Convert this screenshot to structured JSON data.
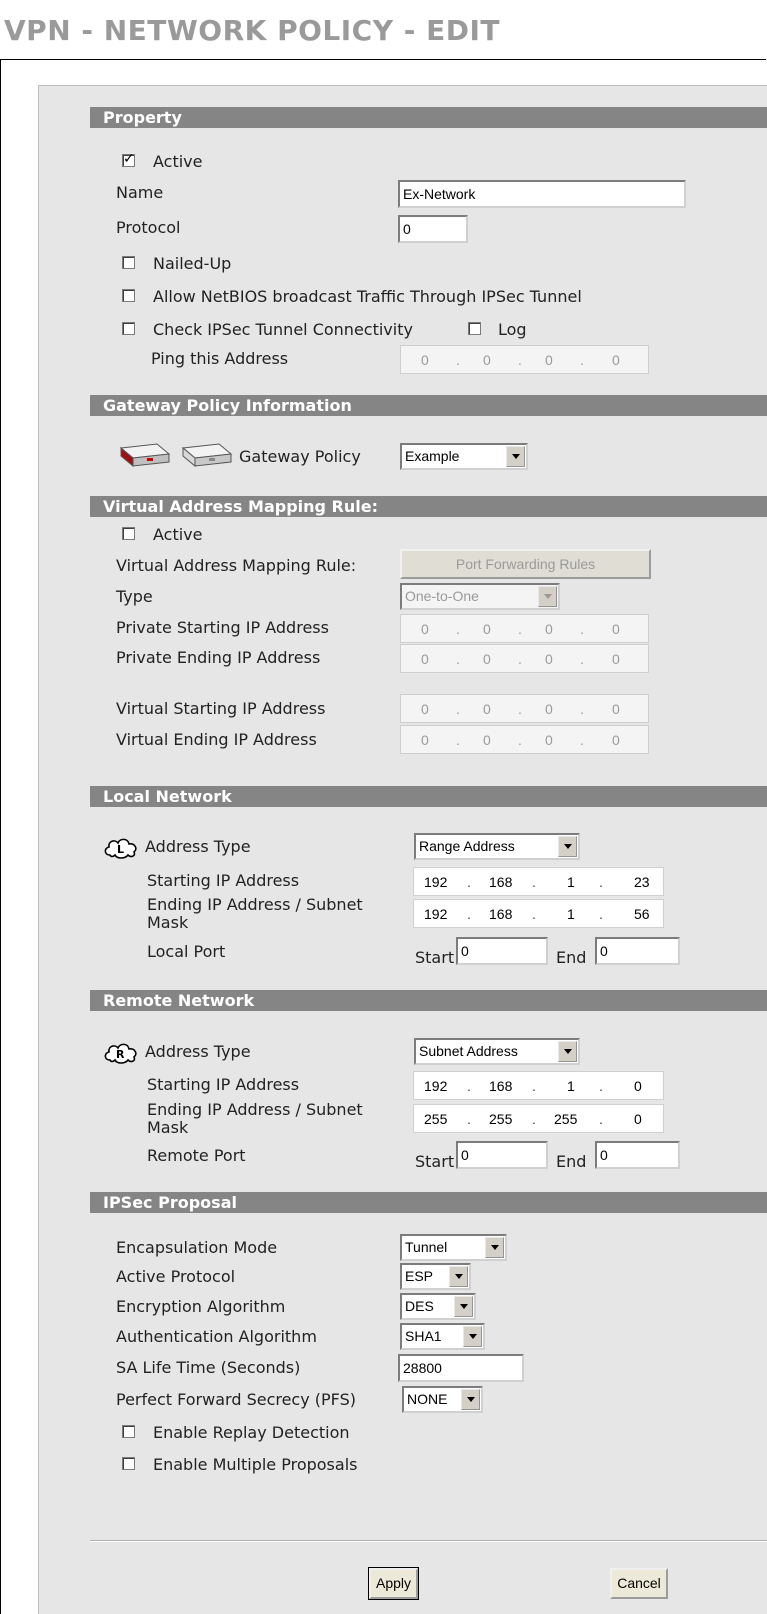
{
  "page_title": "VPN - NETWORK POLICY - EDIT",
  "property": {
    "header": "Property",
    "active_label": "Active",
    "name_label": "Name",
    "name_value": "Ex-Network",
    "protocol_label": "Protocol",
    "protocol_value": "0",
    "nailed_up_label": "Nailed-Up",
    "netbios_label": "Allow NetBIOS broadcast Traffic Through IPSec Tunnel",
    "check_ipsec_label": "Check IPSec Tunnel Connectivity",
    "log_label": "Log",
    "ping_label": "Ping this Address",
    "ping_ip": [
      "0",
      "0",
      "0",
      "0"
    ]
  },
  "gateway": {
    "header": "Gateway Policy Information",
    "policy_label": "Gateway Policy",
    "policy_value": "Example"
  },
  "vamr": {
    "header": "Virtual Address Mapping Rule:",
    "active_label": "Active",
    "rule_label": "Virtual Address Mapping Rule:",
    "port_forwarding_button": "Port Forwarding Rules",
    "type_label": "Type",
    "type_value": "One-to-One",
    "private_start_label": "Private Starting IP Address",
    "private_start_ip": [
      "0",
      "0",
      "0",
      "0"
    ],
    "private_end_label": "Private Ending IP Address",
    "private_end_ip": [
      "0",
      "0",
      "0",
      "0"
    ],
    "virtual_start_label": "Virtual Starting IP Address",
    "virtual_start_ip": [
      "0",
      "0",
      "0",
      "0"
    ],
    "virtual_end_label": "Virtual Ending IP Address",
    "virtual_end_ip": [
      "0",
      "0",
      "0",
      "0"
    ]
  },
  "local": {
    "header": "Local Network",
    "address_type_label": "Address Type",
    "address_type_value": "Range Address",
    "start_label": "Starting IP Address",
    "start_ip": [
      "192",
      "168",
      "1",
      "23"
    ],
    "end_label_line1": "Ending IP Address / Subnet",
    "end_label_line2": "Mask",
    "end_ip": [
      "192",
      "168",
      "1",
      "56"
    ],
    "port_label": "Local Port",
    "start_word": "Start",
    "start_port": "0",
    "end_word": "End",
    "end_port": "0"
  },
  "remote": {
    "header": "Remote Network",
    "address_type_label": "Address Type",
    "address_type_value": "Subnet Address",
    "start_label": "Starting IP Address",
    "start_ip": [
      "192",
      "168",
      "1",
      "0"
    ],
    "end_label_line1": "Ending IP Address / Subnet",
    "end_label_line2": "Mask",
    "end_ip": [
      "255",
      "255",
      "255",
      "0"
    ],
    "port_label": "Remote Port",
    "start_word": "Start",
    "start_port": "0",
    "end_word": "End",
    "end_port": "0"
  },
  "ipsec": {
    "header": "IPSec Proposal",
    "encap_label": "Encapsulation Mode",
    "encap_value": "Tunnel",
    "protocol_label": "Active Protocol",
    "protocol_value": "ESP",
    "encryption_label": "Encryption Algorithm",
    "encryption_value": "DES",
    "auth_label": "Authentication Algorithm",
    "auth_value": "SHA1",
    "sa_label": "SA Life Time (Seconds)",
    "sa_value": "28800",
    "pfs_label": "Perfect Forward Secrecy (PFS)",
    "pfs_value": "NONE",
    "replay_label": "Enable Replay Detection",
    "multiple_label": "Enable Multiple Proposals"
  },
  "buttons": {
    "apply": "Apply",
    "cancel": "Cancel"
  },
  "checks": {
    "property_active": true,
    "nailed_up": false,
    "netbios": false,
    "check_ipsec": false,
    "log": false,
    "vamr_active": false,
    "replay": false,
    "multiple": false
  },
  "colors": {
    "section_header_bg": "#858585",
    "panel_bg": "#e6e6e6",
    "title": "#9a9a9a"
  }
}
